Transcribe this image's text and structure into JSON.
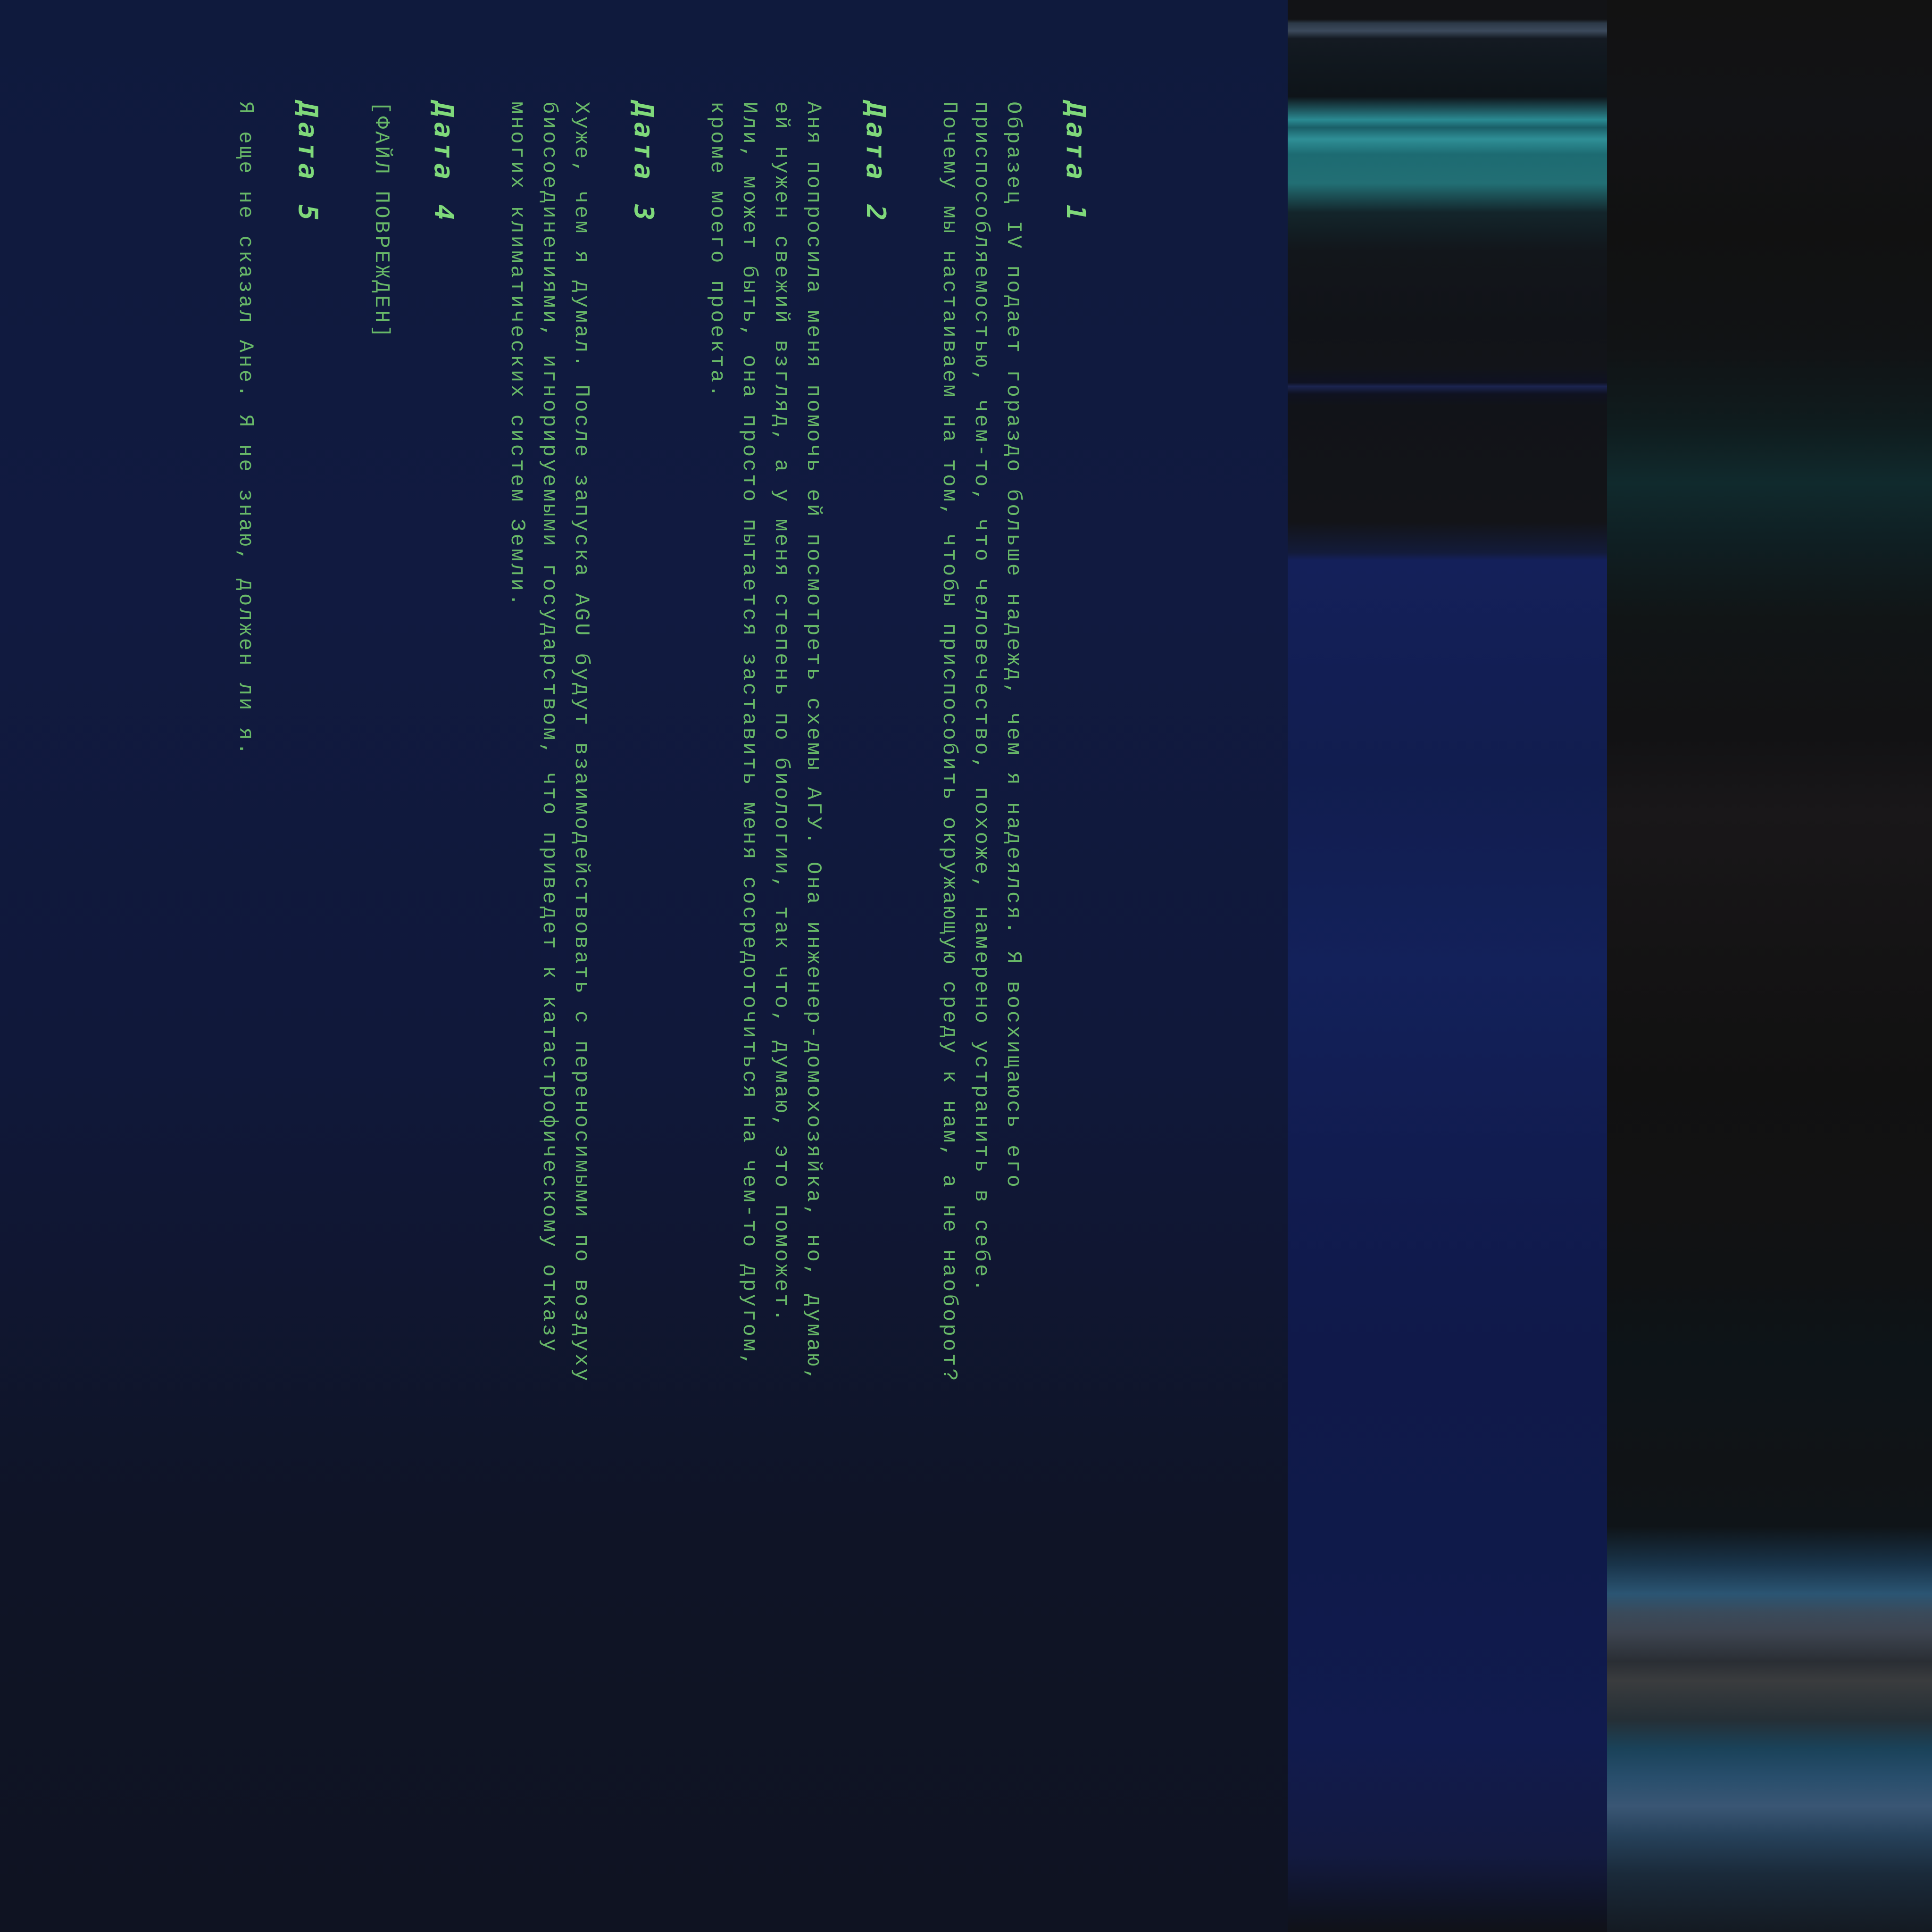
{
  "log": {
    "entries": [
      {
        "title": "Дата 1",
        "lines": [
          "Образец IV подает гораздо больше надежд, чем я надеялся. Я восхищаюсь его",
          "приспособляемостью, чем-то, что человечество, похоже, намерено устранить в себе.",
          "Почему мы настаиваем на том, чтобы приспособить окружающую среду к нам, а не наоборот?"
        ]
      },
      {
        "title": "Дата 2",
        "lines": [
          "Аня попросила меня помочь ей посмотреть схемы АГУ. Она инженер-домохозяйка, но, думаю,",
          "ей нужен свежий взгляд, а у меня степень по биологии, так что, думаю, это поможет.",
          "Или, может быть, она просто пытается заставить меня сосредоточиться на чем-то другом,",
          "кроме моего проекта."
        ]
      },
      {
        "title": "Дата 3",
        "lines": [
          "Хуже, чем я думал. После запуска AGU будут взаимодействовать с переносимыми по воздуху",
          "биосоединениями, игнорируемыми государством, что приведет к катастрофическому отказу",
          "многих климатических систем Земли."
        ]
      },
      {
        "title": "Дата 4",
        "lines": [
          "[ФАЙЛ ПОВРЕЖДЕН]"
        ]
      },
      {
        "title": "Дата 5",
        "lines": [
          "Я еще не сказал Ане. Я не знаю, должен ли я."
        ]
      }
    ]
  },
  "colors": {
    "text": "#68b868",
    "heading": "#7fd97a",
    "panel_background": "#111b4e"
  }
}
